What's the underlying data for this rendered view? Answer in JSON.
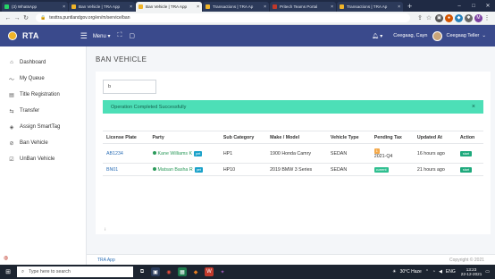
{
  "browser": {
    "tabs": [
      {
        "title": "(3) WhatsApp",
        "color": "#25d366",
        "active": false
      },
      {
        "title": "Ban Vehicle | TRA App",
        "color": "#f0b429",
        "active": false
      },
      {
        "title": "Ban Vehicle | TRA App",
        "color": "#f0b429",
        "active": true
      },
      {
        "title": "Transactions | TRA Ap",
        "color": "#f0b429",
        "active": false
      },
      {
        "title": "Pritech Teams Portal",
        "color": "#c0392b",
        "active": false
      },
      {
        "title": "Transactions | TRA Ap",
        "color": "#f0b429",
        "active": false
      }
    ],
    "new_tab": "+",
    "url": "testtra.puntlandgov.org/en/m/service/ban",
    "profile_initial": "M"
  },
  "header": {
    "brand": "RTA",
    "menu_label": "Menu",
    "username": "Ceegaag, Cayn",
    "role": "Ceegaag Teller"
  },
  "sidebar": {
    "items": [
      {
        "icon": "home-icon",
        "label": "Dashboard"
      },
      {
        "icon": "queue-icon",
        "label": "My Queue"
      },
      {
        "icon": "document-icon",
        "label": "Title Registration"
      },
      {
        "icon": "transfer-icon",
        "label": "Transfer"
      },
      {
        "icon": "tag-icon",
        "label": "Assign SmartTag"
      },
      {
        "icon": "ban-icon",
        "label": "Ban Vehicle"
      },
      {
        "icon": "check-square-icon",
        "label": "UnBan Vehicle"
      }
    ]
  },
  "main": {
    "title": "BAN VEHICLE",
    "search_value": "b",
    "alert": "Operation Completed Successfully",
    "table": {
      "headers": [
        "License Plate",
        "Party",
        "Sub Category",
        "Make / Model",
        "Vehicle Type",
        "Pending Tax",
        "Updated At",
        "Action"
      ],
      "rows": [
        {
          "plate": "AB1234",
          "party": "Kane Williams K",
          "party_badge": "pet",
          "sub_category": "HP1",
          "make_model": "1900 Honda Camry",
          "vehicle_type": "SEDAN",
          "tax_badge": "1",
          "tax_period": "2021-Q4",
          "updated": "16 hours ago",
          "action": "start"
        },
        {
          "plate": "BN01",
          "party": "Matsan Basha R",
          "party_badge": "pet",
          "sub_category": "HP10",
          "make_model": "2019 BMW 3 Series",
          "vehicle_type": "SEDAN",
          "tax_badge": "current",
          "tax_period": "",
          "updated": "21 hours ago",
          "action": "start"
        }
      ]
    }
  },
  "footer": {
    "left": "TRA App",
    "right": "Copyright © 2021"
  },
  "taskbar": {
    "search_placeholder": "Type here to search",
    "weather": "30°C  Haze",
    "language": "ENG",
    "time": "13:23",
    "date": "22-12-2021"
  },
  "colors": {
    "header": "#3a4a8c",
    "alert": "#4ddfb7",
    "link": "#2c6fb6",
    "start_button": "#1ea97c"
  }
}
